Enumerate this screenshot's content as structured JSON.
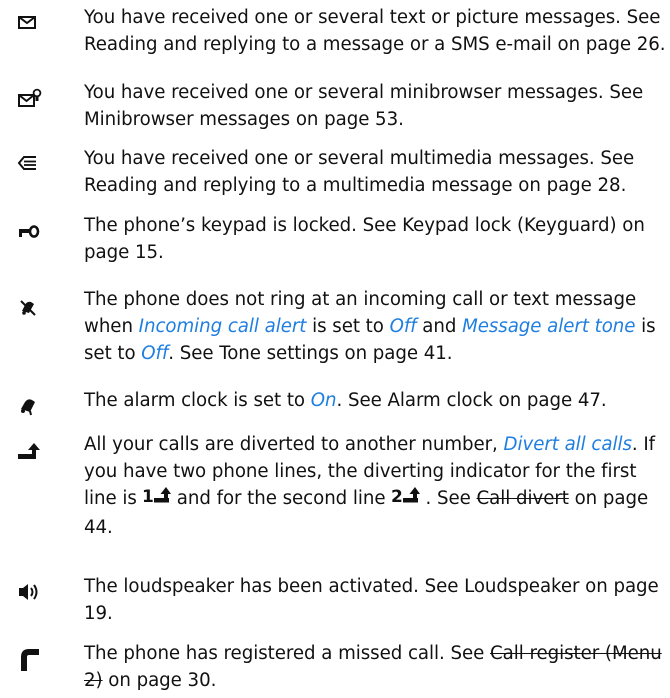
{
  "indicators": [
    {
      "icon": "envelope-icon",
      "text": "You have received one or several text or picture messages. See Reading and replying to a message or a SMS e-mail on page 26."
    },
    {
      "icon": "minibrowser-envelope-icon",
      "text": "You have received one or several minibrowser messages. See Minibrowser messages on page 53."
    },
    {
      "icon": "multimedia-envelope-icon",
      "text": "You have received one or several multimedia messages. See Reading and replying to a multimedia message on page 28."
    },
    {
      "icon": "key-icon",
      "text": "The phone’s keypad is locked. See Keypad lock (Keyguard) on page 15."
    },
    {
      "icon": "silent-bell-icon",
      "parts": [
        "The phone does not ring at an incoming call or text message when ",
        "Incoming call alert",
        " is set to ",
        "Off",
        " and ",
        "Message alert tone",
        " is set to ",
        "Off",
        ". See Tone settings on page 41."
      ]
    },
    {
      "icon": "alarm-bell-icon",
      "parts": [
        "The alarm clock is set to ",
        "On",
        ". See Alarm clock on page 47."
      ]
    },
    {
      "icon": "divert-arrow-icon",
      "parts": [
        "All your calls are diverted to another number, ",
        "Divert all calls",
        ". If you have two phone lines, the diverting indicator for the first line is",
        "and for the second line",
        ". See ",
        "Call divert",
        " on page 44."
      ],
      "line_indicators": [
        "1",
        "2"
      ]
    },
    {
      "icon": "loudspeaker-icon",
      "text": "The loudspeaker has been activated. See Loudspeaker on page 19."
    },
    {
      "icon": "missed-call-icon",
      "parts": [
        "The phone has registered a missed call. See ",
        "Call register (Menu 2)",
        " on page 30."
      ]
    }
  ]
}
